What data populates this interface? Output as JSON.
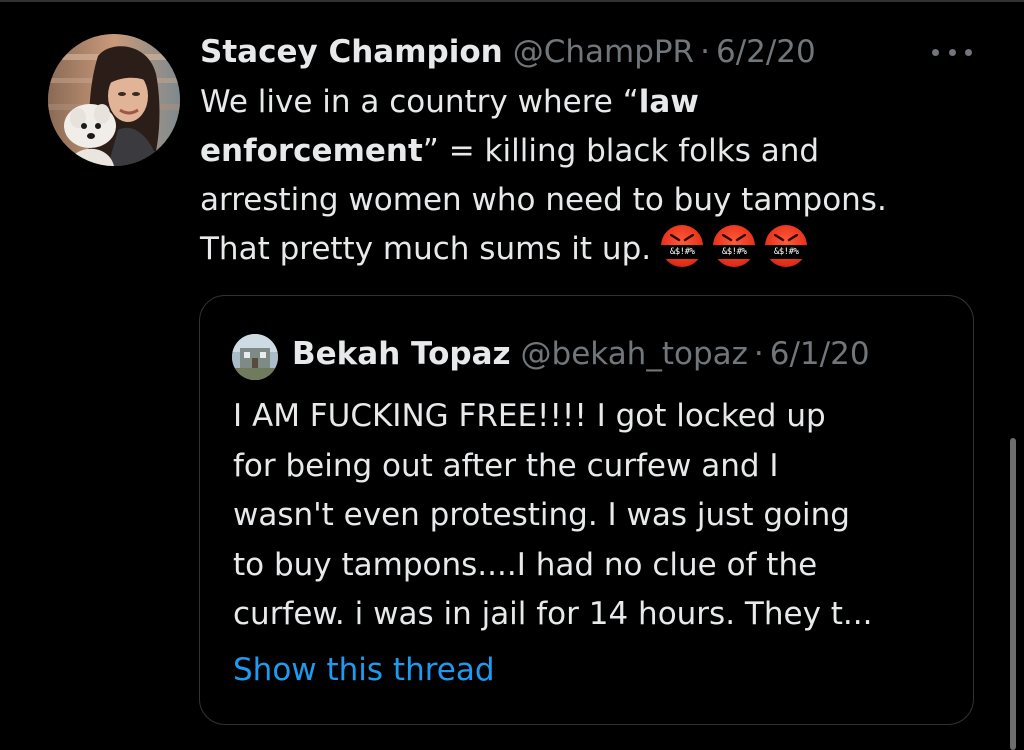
{
  "tweet": {
    "author": {
      "display_name": "Stacey Champion",
      "handle": "@ChampPR",
      "separator": "·",
      "date": "6/2/20"
    },
    "text": {
      "line1_pre": "We live in a country where “",
      "line1_bold": "law",
      "line2_bold": "enforcement",
      "line2_post": "” = killing black folks and",
      "line3": "arresting women who need to buy tampons.",
      "line4": "That pretty much sums it up."
    },
    "emojis": [
      "&$!#%",
      "&$!#%",
      "&$!#%"
    ],
    "emoji_name": "face-with-symbols-on-mouth-icon",
    "more_icon": "more-options-icon"
  },
  "quoted_tweet": {
    "author": {
      "display_name": "Bekah Topaz",
      "handle": "@bekah_topaz",
      "separator": "·",
      "date": "6/1/20"
    },
    "lines": [
      "I AM FUCKING FREE!!!! I got locked up",
      "for being out after the curfew and I",
      "wasn't even protesting. I was just going",
      "to buy tampons....I had no clue of the",
      "curfew. i was in jail for 14 hours. They t..."
    ],
    "show_thread": "Show this thread"
  },
  "colors": {
    "background": "#000000",
    "text": "#e7e9ea",
    "secondary": "#71767b",
    "link": "#1d9bf0",
    "border": "#2f3336"
  }
}
